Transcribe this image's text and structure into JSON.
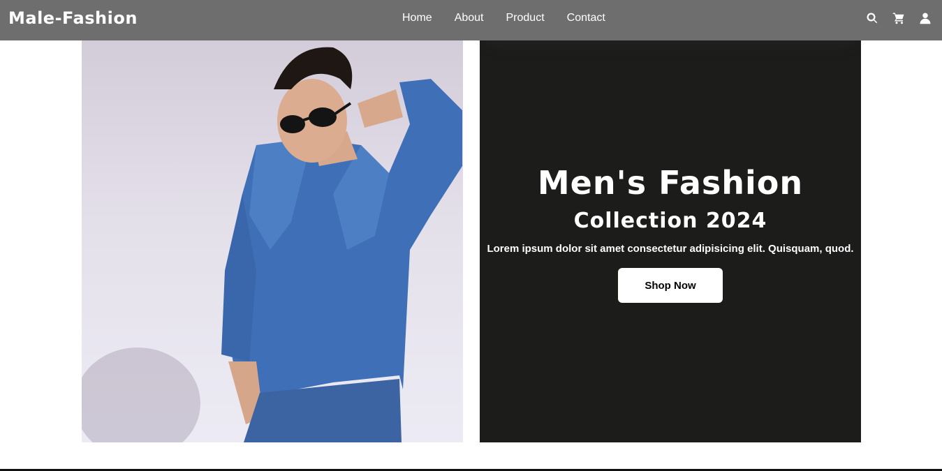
{
  "header": {
    "logo": "Male-Fashion",
    "nav": [
      "Home",
      "About",
      "Product",
      "Contact"
    ],
    "icons": [
      "search-icon",
      "cart-icon",
      "user-icon"
    ]
  },
  "hero": {
    "title": "Men's Fashion",
    "subtitle": "Collection 2024",
    "description": "Lorem ipsum dolor sit amet consectetur adipisicing elit. Quisquam, quod.",
    "button_label": "Shop Now"
  },
  "colors": {
    "navbar": "#6e6e6e",
    "panel": "#1c1c1a",
    "button": "#ffffff"
  }
}
